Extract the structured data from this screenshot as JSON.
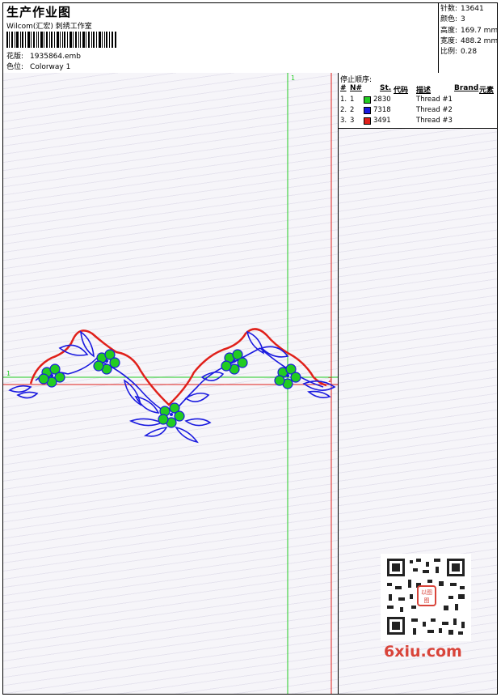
{
  "header": {
    "title": "生产作业图",
    "company": "Wilcom(汇宏) 刺绣工作室",
    "design_label": "花版:",
    "design_value": "1935864.emb",
    "colorway_label": "色位:",
    "colorway_value": "Colorway 1"
  },
  "stats": [
    {
      "label": "针数:",
      "value": "13641"
    },
    {
      "label": "颜色:",
      "value": "3"
    },
    {
      "label": "高度:",
      "value": "169.7 mm"
    },
    {
      "label": "宽度:",
      "value": "488.2 mm"
    },
    {
      "label": "比例:",
      "value": "0.28"
    }
  ],
  "thread_panel": {
    "title": "停止顺序:",
    "columns": [
      "#",
      "N#",
      "St.",
      "代码",
      "描述",
      "Brand",
      "元素"
    ],
    "rows": [
      {
        "index": "1.",
        "n": "1",
        "color": "#22cc22",
        "code": "2830",
        "desc": "Thread #1"
      },
      {
        "index": "2.",
        "n": "2",
        "color": "#1a1adf",
        "code": "7318",
        "desc": "Thread #2"
      },
      {
        "index": "3.",
        "n": "3",
        "color": "#e0201a",
        "code": "3491",
        "desc": "Thread #3"
      }
    ]
  },
  "canvas": {
    "markers": {
      "top": "1",
      "left": "1",
      "right": "2"
    },
    "guide_color": "#22cc22",
    "border_color": "#e0201a"
  },
  "watermark": {
    "logo": "6xiu.com",
    "stamp": "以图图"
  }
}
